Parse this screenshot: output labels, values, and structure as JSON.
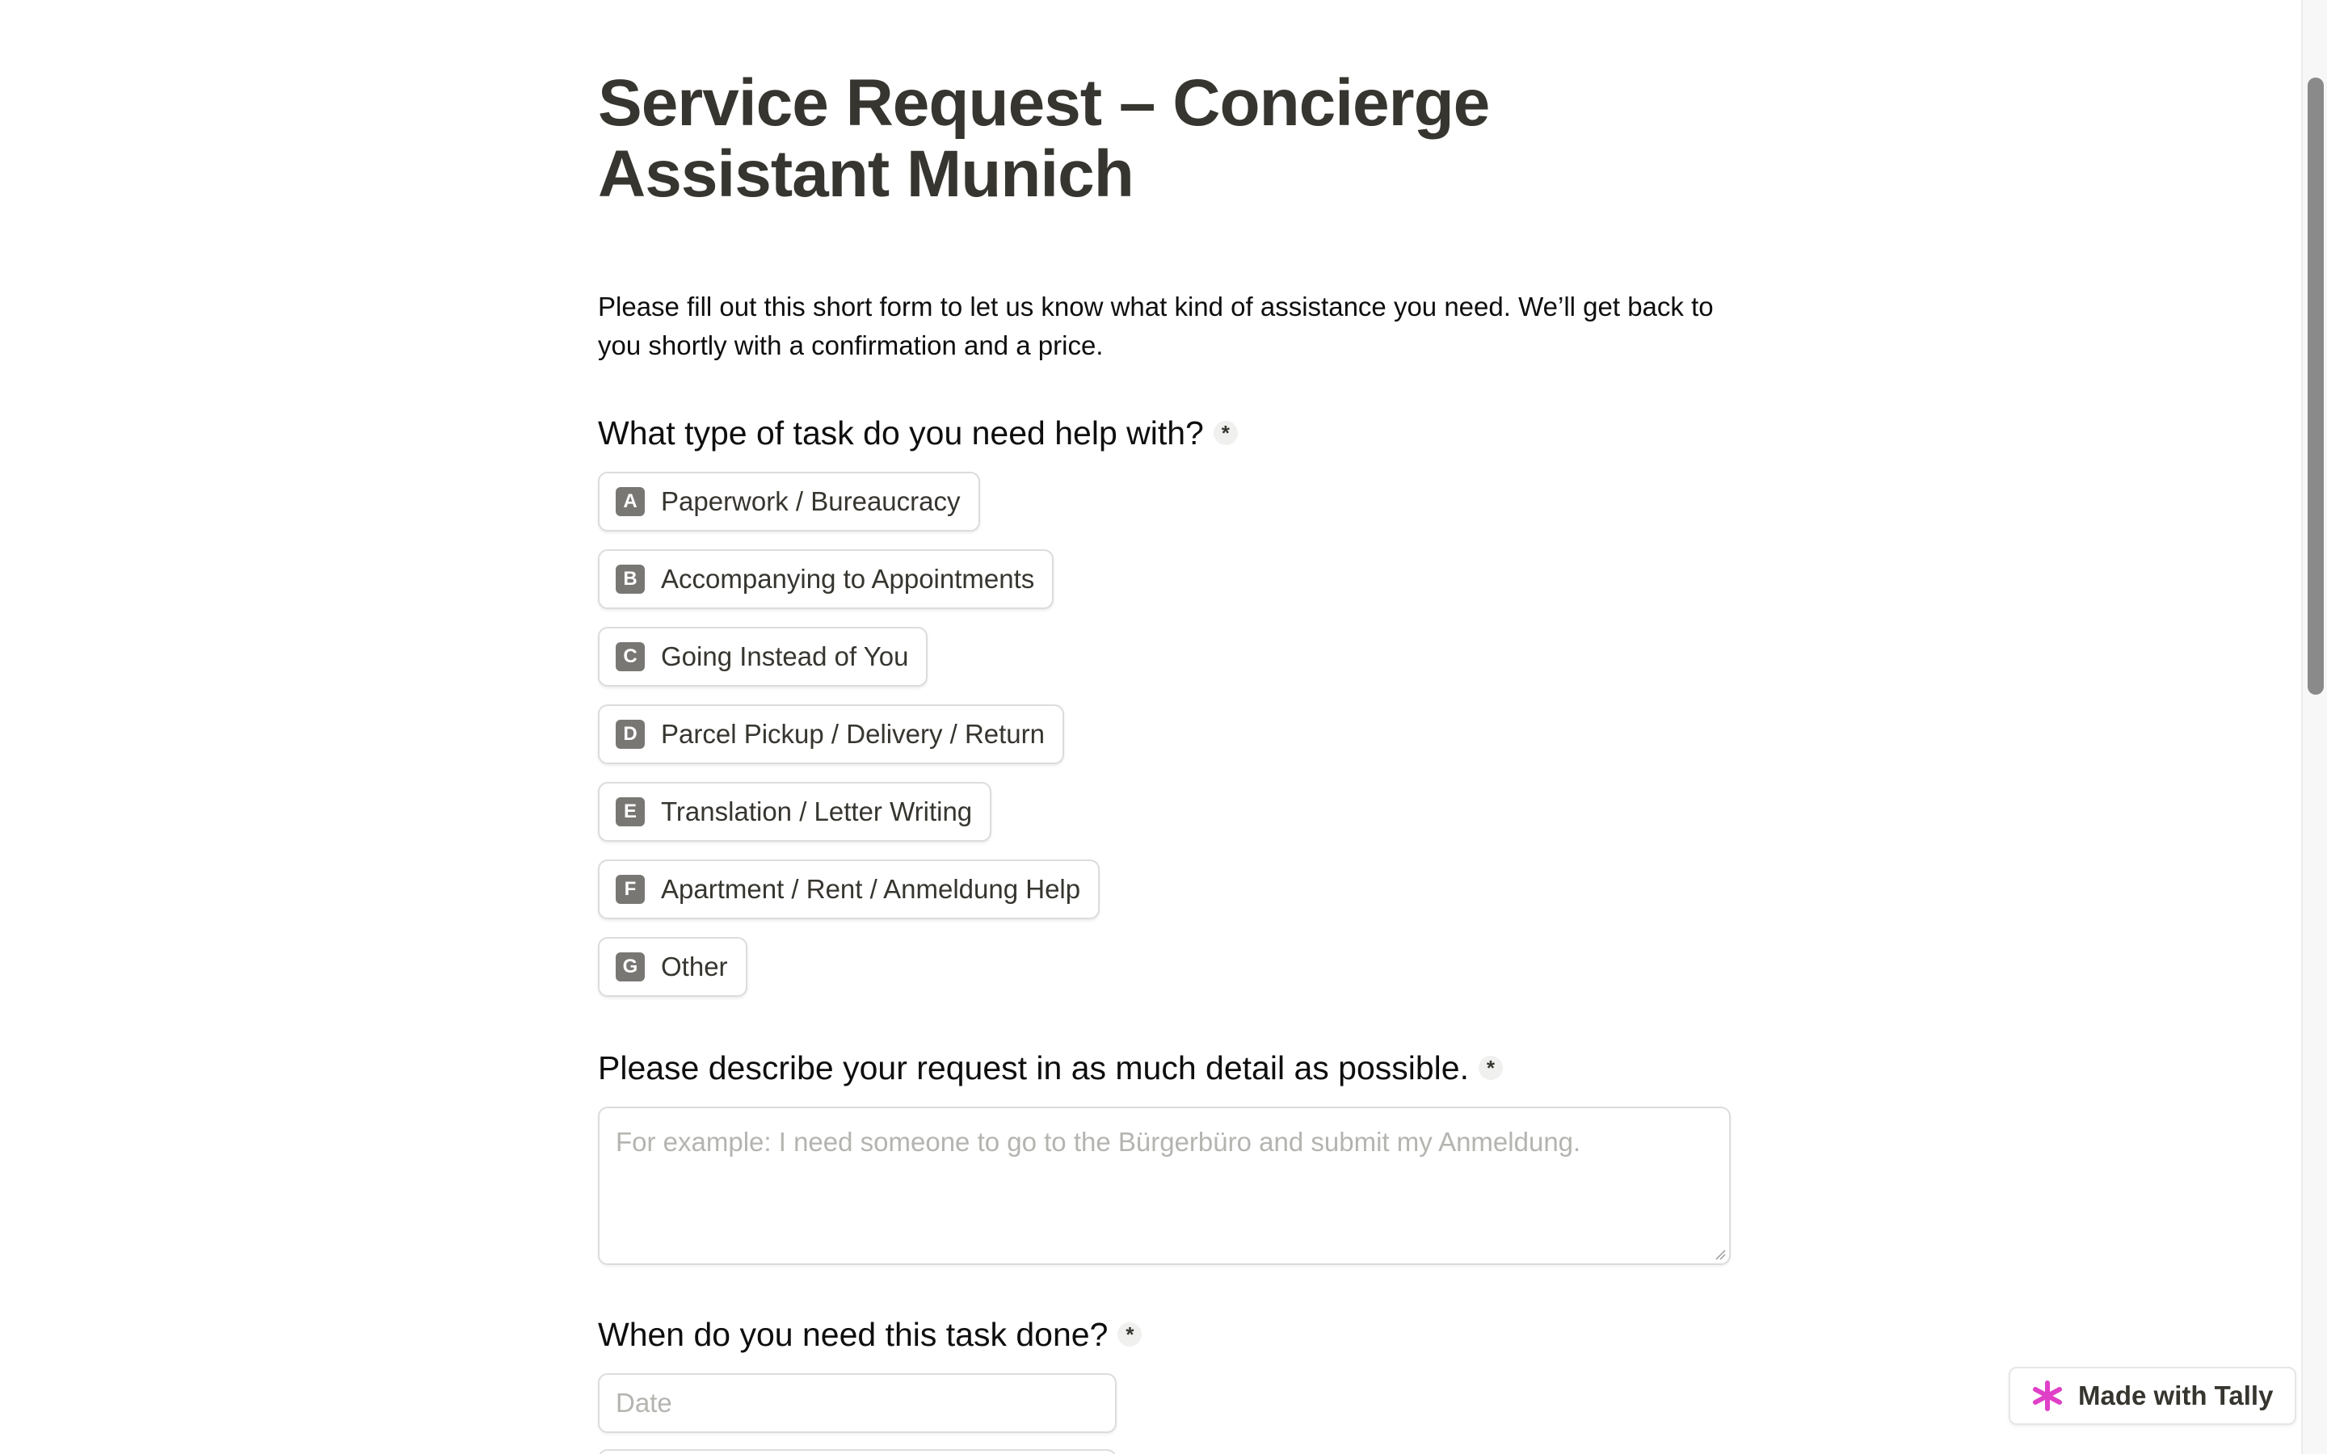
{
  "form": {
    "title": "Service Request – Concierge Assistant Munich",
    "description": "Please fill out this short form to let us know what kind of assistance you need. We’ll get back to you shortly with a confirmation and a price."
  },
  "questions": {
    "task_type": {
      "label": "What type of task do you need help with?",
      "required_mark": "*",
      "options": [
        {
          "key": "A",
          "label": "Paperwork / Bureaucracy"
        },
        {
          "key": "B",
          "label": "Accompanying to Appointments"
        },
        {
          "key": "C",
          "label": "Going Instead of You"
        },
        {
          "key": "D",
          "label": "Parcel Pickup / Delivery / Return"
        },
        {
          "key": "E",
          "label": "Translation / Letter Writing"
        },
        {
          "key": "F",
          "label": "Apartment / Rent / Anmeldung Help"
        },
        {
          "key": "G",
          "label": "Other"
        }
      ]
    },
    "description": {
      "label": "Please describe your request in as much detail as possible.",
      "required_mark": "*",
      "placeholder": "For example: I need someone to go to the Bürgerbüro and submit my Anmeldung."
    },
    "when": {
      "label": "When do you need this task done?",
      "required_mark": "*",
      "date_placeholder": "Date"
    }
  },
  "branding": {
    "made_with_label": "Made with Tally",
    "logo_icon": "tally-asterisk-icon",
    "logo_color": "#e040c8"
  },
  "colors": {
    "text": "#37352f",
    "key_badge": "#787774",
    "border": "#dcdcdb",
    "placeholder": "#b4b4b0"
  }
}
